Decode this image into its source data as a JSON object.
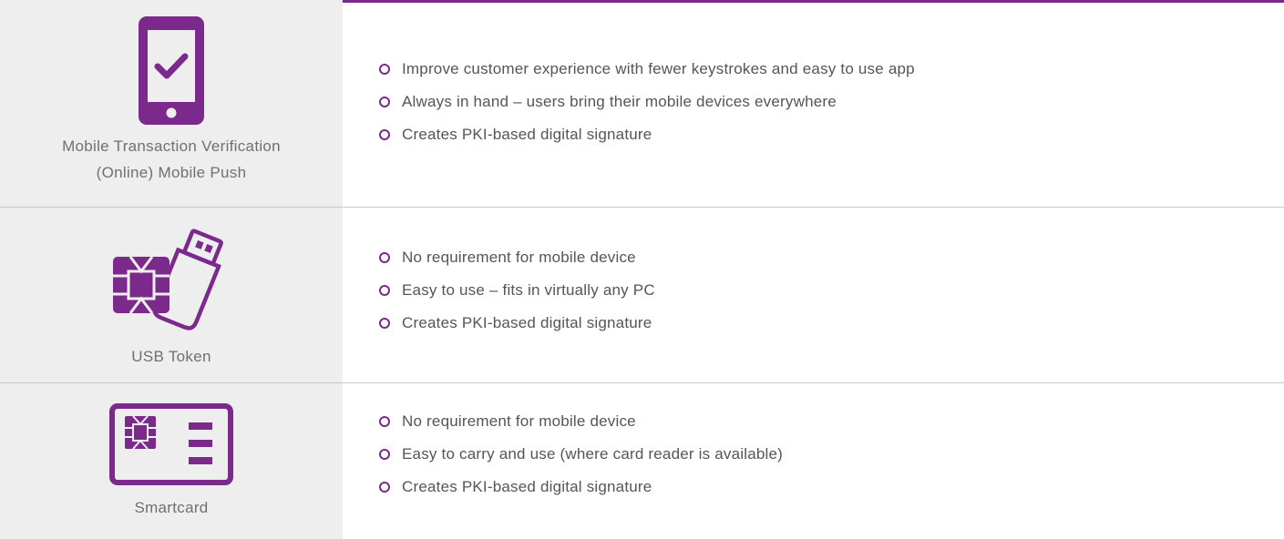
{
  "accent_color": "#7b2a8c",
  "rows": [
    {
      "icon": "mobile-phone-check-icon",
      "label_lines": [
        "Mobile Transaction Verification",
        "(Online) Mobile Push"
      ],
      "bullets": [
        "Improve customer experience with fewer keystrokes and easy to use app",
        "Always in hand – users bring their mobile devices everywhere",
        "Creates PKI-based digital signature"
      ]
    },
    {
      "icon": "usb-token-chip-icon",
      "label_lines": [
        "USB Token"
      ],
      "bullets": [
        "No requirement for mobile device",
        "Easy to use – fits in virtually any PC",
        "Creates PKI-based digital signature"
      ]
    },
    {
      "icon": "smartcard-icon",
      "label_lines": [
        "Smartcard"
      ],
      "bullets": [
        "No requirement for mobile device",
        "Easy to carry and use (where card reader is available)",
        "Creates PKI-based digital signature"
      ]
    }
  ]
}
